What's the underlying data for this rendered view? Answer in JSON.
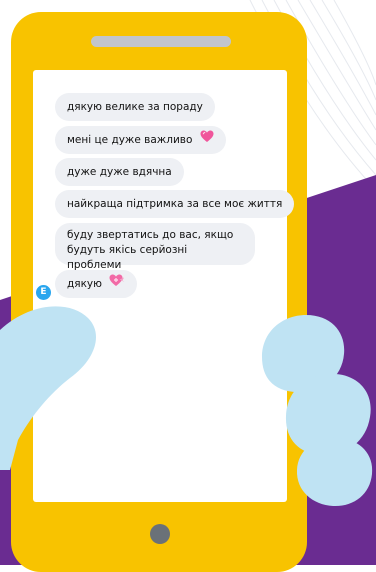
{
  "colors": {
    "phone_body": "#f8c300",
    "background_shape": "#6a2c91",
    "hand": "#bfe3f3",
    "bubble": "#eef0f4",
    "avatar": "#2aa6ee"
  },
  "messages": [
    {
      "text": "дякую велике за пораду",
      "icon": null
    },
    {
      "text": "мені це дуже важливо",
      "icon": "pink-heart-icon"
    },
    {
      "text": "дуже дуже вдячна",
      "icon": null
    },
    {
      "text": "найкраща підтримка за все моє життя",
      "icon": null
    },
    {
      "text": "буду звертатись до вас, якщо будуть якісь серйозні проблеми",
      "icon": null
    },
    {
      "text": "дякую",
      "icon": "heart-with-ribbon-icon"
    }
  ],
  "sender_avatar": {
    "initial": "E"
  }
}
